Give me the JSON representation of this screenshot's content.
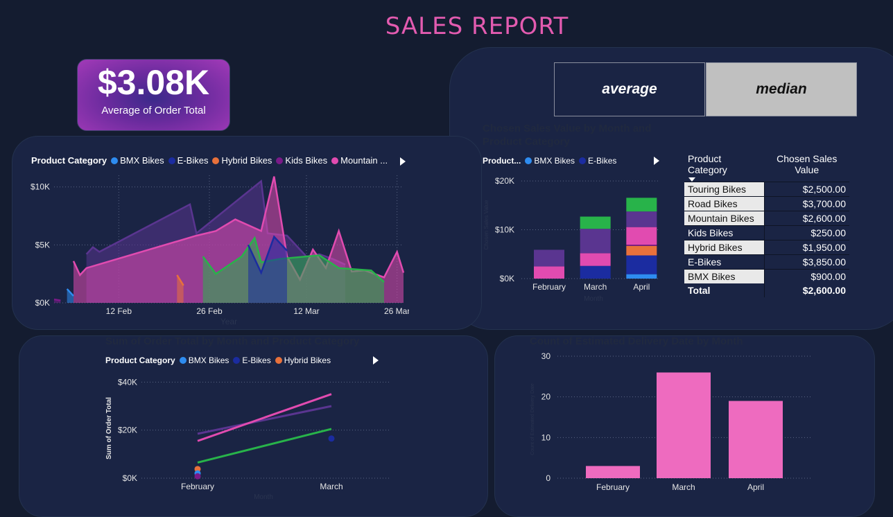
{
  "title": "SALES REPORT",
  "kpi": {
    "value": "$3.08K",
    "label": "Average of Order Total"
  },
  "buttons": {
    "average": "average",
    "median": "median"
  },
  "faint_titles": {
    "chosen": "Chosen Sales Value by Month and Product Category",
    "sum": "Sum of Order Total by Month and Product Category",
    "count": "Count of Estimated Delivery Date by Month"
  },
  "area_legend": {
    "title": "Product Category",
    "items": [
      "BMX Bikes",
      "E-Bikes",
      "Hybrid Bikes",
      "Kids Bikes",
      "Mountain ..."
    ]
  },
  "stack_legend": {
    "title": "Product...",
    "items": [
      "BMX Bikes",
      "E-Bikes"
    ]
  },
  "line_legend": {
    "title": "Product Category",
    "items": [
      "BMX Bikes",
      "E-Bikes",
      "Hybrid Bikes"
    ]
  },
  "colors": {
    "bmx": "#2e8cf0",
    "ebikes": "#1b2ca0",
    "hybrid": "#e8713b",
    "kids": "#7a1a88",
    "mountain": "#e14bb0",
    "road": "#5a3590",
    "touring": "#28b34a",
    "accent": "#e35bb0"
  },
  "table": {
    "headers": [
      "Product Category",
      "Chosen Sales Value"
    ],
    "rows": [
      {
        "category": "Touring Bikes",
        "value": "$2,500.00"
      },
      {
        "category": "Road Bikes",
        "value": "$3,700.00"
      },
      {
        "category": "Mountain Bikes",
        "value": "$2,600.00"
      },
      {
        "category": "Kids Bikes",
        "value": "$250.00"
      },
      {
        "category": "Hybrid Bikes",
        "value": "$1,950.00"
      },
      {
        "category": "E-Bikes",
        "value": "$3,850.00"
      },
      {
        "category": "BMX Bikes",
        "value": "$900.00"
      }
    ],
    "total_label": "Total",
    "total_value": "$2,600.00"
  },
  "chart_data": [
    {
      "type": "area",
      "title": "",
      "xlabel": "Year",
      "ylabel": "",
      "ylim": [
        0,
        11000
      ],
      "xlim": [
        "2024-02-02",
        "2024-03-27"
      ],
      "x_ticks": [
        "12 Feb",
        "26 Feb",
        "12 Mar",
        "26 Mar"
      ],
      "x_tick_dates": [
        "2024-02-12",
        "2024-02-26",
        "2024-03-12",
        "2024-03-26"
      ],
      "y_ticks": [
        "$0K",
        "$5K",
        "$10K"
      ],
      "y_tick_values": [
        0,
        5000,
        10000
      ],
      "series": [
        {
          "name": "Road Bikes",
          "color": "#5a3590",
          "points": [
            [
              "2024-02-07",
              4200
            ],
            [
              "2024-02-08",
              4800
            ],
            [
              "2024-02-09",
              4400
            ],
            [
              "2024-02-23",
              8500
            ],
            [
              "2024-02-24",
              6000
            ],
            [
              "2024-03-05",
              10500
            ],
            [
              "2024-03-06",
              6000
            ],
            [
              "2024-03-09",
              5800
            ],
            [
              "2024-03-12",
              4000
            ],
            [
              "2024-03-14",
              4200
            ],
            [
              "2024-03-16",
              3800
            ],
            [
              "2024-03-18",
              3300
            ]
          ]
        },
        {
          "name": "Mountain ...",
          "color": "#e14bb0",
          "points": [
            [
              "2024-02-05",
              3600
            ],
            [
              "2024-02-06",
              2400
            ],
            [
              "2024-02-07",
              3000
            ],
            [
              "2024-02-24",
              5800
            ],
            [
              "2024-02-27",
              6200
            ],
            [
              "2024-03-01",
              7200
            ],
            [
              "2024-03-05",
              6200
            ],
            [
              "2024-03-07",
              10900
            ],
            [
              "2024-03-09",
              4000
            ],
            [
              "2024-03-11",
              2000
            ],
            [
              "2024-03-13",
              4600
            ],
            [
              "2024-03-15",
              3000
            ],
            [
              "2024-03-17",
              6200
            ],
            [
              "2024-03-19",
              2700
            ],
            [
              "2024-03-21",
              2800
            ],
            [
              "2024-03-24",
              2200
            ],
            [
              "2024-03-26",
              4400
            ],
            [
              "2024-03-27",
              2600
            ]
          ]
        },
        {
          "name": "Touring Bikes",
          "color": "#28b34a",
          "points": [
            [
              "2024-02-25",
              4000
            ],
            [
              "2024-02-27",
              2500
            ],
            [
              "2024-03-02",
              4000
            ],
            [
              "2024-03-04",
              5600
            ],
            [
              "2024-03-05",
              3500
            ],
            [
              "2024-03-08",
              3800
            ],
            [
              "2024-03-14",
              4100
            ],
            [
              "2024-03-17",
              3000
            ],
            [
              "2024-03-22",
              2800
            ],
            [
              "2024-03-24",
              1800
            ]
          ]
        },
        {
          "name": "E-Bikes",
          "color": "#1b2ca0",
          "points": [
            [
              "2024-03-03",
              5000
            ],
            [
              "2024-03-05",
              2600
            ],
            [
              "2024-03-07",
              5700
            ],
            [
              "2024-03-09",
              4500
            ]
          ]
        },
        {
          "name": "Hybrid Bikes",
          "color": "#e8713b",
          "points": [
            [
              "2024-02-21",
              2400
            ],
            [
              "2024-02-22",
              1500
            ]
          ]
        },
        {
          "name": "BMX Bikes",
          "color": "#2e8cf0",
          "points": [
            [
              "2024-02-04",
              1200
            ],
            [
              "2024-02-05",
              600
            ]
          ]
        },
        {
          "name": "Kids Bikes",
          "color": "#7a1a88",
          "points": [
            [
              "2024-02-02",
              300
            ],
            [
              "2024-02-03",
              200
            ]
          ]
        }
      ]
    },
    {
      "type": "bar",
      "title": "Chosen Sales Value by Month and Product Category",
      "xlabel": "Month",
      "ylabel": "Chosen Sales Value",
      "categories": [
        "February",
        "March",
        "April"
      ],
      "ylim": [
        0,
        22000
      ],
      "y_ticks": [
        "$0K",
        "$10K",
        "$20K"
      ],
      "y_tick_values": [
        0,
        10000,
        20000
      ],
      "stacked": true,
      "series": [
        {
          "name": "BMX Bikes",
          "color": "#2e8cf0",
          "values": [
            0,
            0,
            900
          ]
        },
        {
          "name": "E-Bikes",
          "color": "#1b2ca0",
          "values": [
            0,
            2600,
            3850
          ]
        },
        {
          "name": "Hybrid Bikes",
          "color": "#e8713b",
          "values": [
            0,
            0,
            1950
          ]
        },
        {
          "name": "Kids Bikes",
          "color": "#7a1a88",
          "values": [
            0,
            0,
            250
          ]
        },
        {
          "name": "Mountain Bikes",
          "color": "#e14bb0",
          "values": [
            2500,
            2600,
            3600
          ]
        },
        {
          "name": "Road Bikes",
          "color": "#5a3590",
          "values": [
            3400,
            5000,
            3200
          ]
        },
        {
          "name": "Touring Bikes",
          "color": "#28b34a",
          "values": [
            0,
            2500,
            2800
          ]
        }
      ]
    },
    {
      "type": "scatter",
      "title": "Sum of Order Total by Month and Product Category",
      "xlabel": "Month",
      "ylabel": "Sum of Order Total",
      "categories": [
        "February",
        "March"
      ],
      "ylim": [
        0,
        45000
      ],
      "y_ticks": [
        "$0K",
        "$20K",
        "$40K"
      ],
      "y_tick_values": [
        0,
        20000,
        40000
      ],
      "trend_lines": [
        {
          "name": "Road Bikes",
          "color": "#5a3590",
          "values": [
            18500,
            30000
          ]
        },
        {
          "name": "Mountain Bikes",
          "color": "#e14bb0",
          "values": [
            15500,
            35000
          ]
        },
        {
          "name": "Touring Bikes",
          "color": "#28b34a",
          "values": [
            6500,
            20500
          ]
        }
      ],
      "points": [
        {
          "name": "Hybrid Bikes",
          "color": "#e8713b",
          "month": "February",
          "value": 3800
        },
        {
          "name": "BMX Bikes",
          "color": "#2e8cf0",
          "month": "February",
          "value": 2000
        },
        {
          "name": "Kids Bikes",
          "color": "#7a1a88",
          "month": "February",
          "value": 800
        },
        {
          "name": "E-Bikes",
          "color": "#1b2ca0",
          "month": "March",
          "value": 16500
        }
      ]
    },
    {
      "type": "bar",
      "title": "Count of Estimated Delivery Date by Month",
      "xlabel": "Month",
      "ylabel": "Count of Estimated Delivery Date",
      "categories": [
        "February",
        "March",
        "April"
      ],
      "values": [
        3,
        26,
        19
      ],
      "color": "#ee6bbf",
      "ylim": [
        0,
        30
      ],
      "y_ticks": [
        "0",
        "10",
        "20",
        "30"
      ],
      "y_tick_values": [
        0,
        10,
        20,
        30
      ]
    }
  ]
}
